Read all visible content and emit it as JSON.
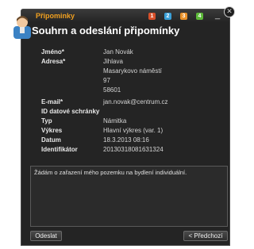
{
  "window": {
    "title": "Připominky",
    "steps": [
      {
        "label": "1",
        "color": "#d8502a"
      },
      {
        "label": "2",
        "color": "#3aa0d8"
      },
      {
        "label": "3",
        "color": "#e89028"
      },
      {
        "label": "4",
        "color": "#5cb838"
      }
    ],
    "minimize_label": "_",
    "close_label": "✕"
  },
  "heading": "Souhrn a odeslání připomínky",
  "fields": [
    {
      "label": "Jméno*",
      "value": "Jan Novák"
    },
    {
      "label": "Adresa*",
      "value": "Jihlava"
    },
    {
      "label": "",
      "value": "Masarykovo náměstí"
    },
    {
      "label": "",
      "value": "97"
    },
    {
      "label": "",
      "value": "58601"
    },
    {
      "label": "E-mail*",
      "value": "jan.novak@centrum.cz"
    },
    {
      "label": "ID datové schránky",
      "value": ""
    },
    {
      "label": "Typ",
      "value": "Námitka"
    },
    {
      "label": "Výkres",
      "value": "Hlavní výkres (var. 1)"
    },
    {
      "label": "Datum",
      "value": "18.3.2013 08:16"
    },
    {
      "label": "Identifikátor",
      "value": "20130318081631324"
    }
  ],
  "note_text": "Žádám o zařazení mého pozemku na bydlení individuální.",
  "buttons": {
    "send": "Odeslat",
    "back": "< Předchozí"
  }
}
